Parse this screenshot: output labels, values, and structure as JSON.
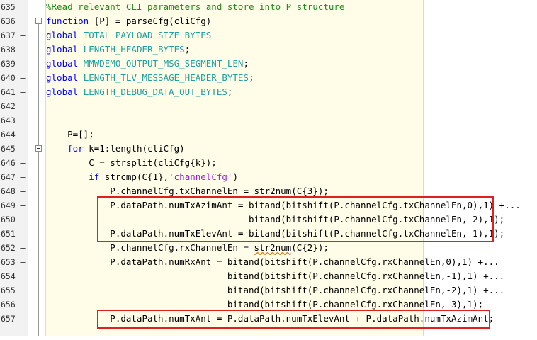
{
  "editor": {
    "lines": [
      {
        "n": "635",
        "mark": "",
        "text": "%Read relevant CLI parameters and store into P structure"
      },
      {
        "n": "636",
        "mark": "",
        "text": "function [P] = parseCfg(cliCfg)"
      },
      {
        "n": "637",
        "mark": "–",
        "text": "global TOTAL_PAYLOAD_SIZE_BYTES"
      },
      {
        "n": "638",
        "mark": "–",
        "text": "global LENGTH_HEADER_BYTES;"
      },
      {
        "n": "639",
        "mark": "–",
        "text": "global MMWDEMO_OUTPUT_MSG_SEGMENT_LEN;"
      },
      {
        "n": "640",
        "mark": "–",
        "text": "global LENGTH_TLV_MESSAGE_HEADER_BYTES;"
      },
      {
        "n": "641",
        "mark": "–",
        "text": "global LENGTH_DEBUG_DATA_OUT_BYTES;"
      },
      {
        "n": "642",
        "mark": "",
        "text": ""
      },
      {
        "n": "643",
        "mark": "",
        "text": ""
      },
      {
        "n": "644",
        "mark": "–",
        "text": "    P=[];"
      },
      {
        "n": "645",
        "mark": "–",
        "text": "    for k=1:length(cliCfg)"
      },
      {
        "n": "646",
        "mark": "–",
        "text": "        C = strsplit(cliCfg{k});"
      },
      {
        "n": "647",
        "mark": "–",
        "text": "        if strcmp(C{1},'channelCfg')"
      },
      {
        "n": "648",
        "mark": "–",
        "text": "            P.channelCfg.txChannelEn = str2num(C{3});"
      },
      {
        "n": "649",
        "mark": "–",
        "text": "            P.dataPath.numTxAzimAnt = bitand(bitshift(P.channelCfg.txChannelEn,0),1) +..."
      },
      {
        "n": "650",
        "mark": "",
        "text": "                                      bitand(bitshift(P.channelCfg.txChannelEn,-2),1);"
      },
      {
        "n": "651",
        "mark": "–",
        "text": "            P.dataPath.numTxElevAnt = bitand(bitshift(P.channelCfg.txChannelEn,-1),1);"
      },
      {
        "n": "652",
        "mark": "–",
        "text": "            P.channelCfg.rxChannelEn = str2num(C{2});"
      },
      {
        "n": "653",
        "mark": "–",
        "text": "            P.dataPath.numRxAnt = bitand(bitshift(P.channelCfg.rxChannelEn,0),1) +..."
      },
      {
        "n": "654",
        "mark": "",
        "text": "                                  bitand(bitshift(P.channelCfg.rxChannelEn,-1),1) +..."
      },
      {
        "n": "655",
        "mark": "",
        "text": "                                  bitand(bitshift(P.channelCfg.rxChannelEn,-2),1) +..."
      },
      {
        "n": "656",
        "mark": "",
        "text": "                                  bitand(bitshift(P.channelCfg.rxChannelEn,-3),1);"
      },
      {
        "n": "657",
        "mark": "–",
        "text": "            P.dataPath.numTxAnt = P.dataPath.numTxElevAnt + P.dataPath.numTxAzimAnt;"
      },
      {
        "n": "",
        "mark": "",
        "text": ""
      }
    ]
  }
}
